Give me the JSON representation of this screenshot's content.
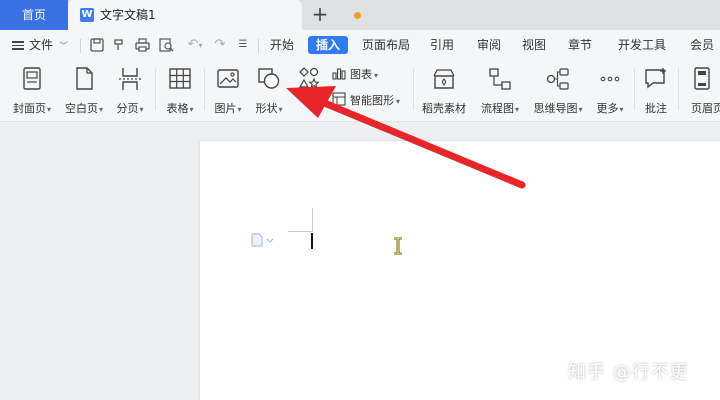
{
  "tabbar": {
    "home_label": "首页",
    "doc_icon_letter": "W",
    "doc_title": "文字文稿1",
    "add_label": "+"
  },
  "menubar": {
    "file_label": "文件",
    "tabs": [
      "开始",
      "插入",
      "页面布局",
      "引用",
      "审阅",
      "视图",
      "章节",
      "开发工具",
      "会员专"
    ],
    "active_tab": "插入"
  },
  "ribbon": {
    "cover_page": "封面页",
    "blank_page": "空白页",
    "page_break": "分页",
    "table": "表格",
    "picture": "图片",
    "shape": "形状",
    "chart": "图表",
    "smart_art": "智能图形",
    "docer_material": "稻壳素材",
    "flowchart": "流程图",
    "mind_map": "思维导图",
    "more": "更多",
    "comment": "批注",
    "header_footer": "页眉页"
  },
  "watermark": "知乎 @行不更",
  "colors": {
    "home_tab": "#3a72e3",
    "active_menu_tab": "#2f7bf5",
    "unsaved_dot": "#f0a020",
    "annotation_arrow": "#e8262a"
  }
}
